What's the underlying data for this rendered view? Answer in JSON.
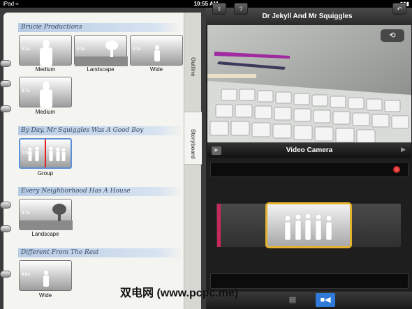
{
  "status_bar": {
    "left": "iPad ≈",
    "time": "10:55 AM",
    "right": "▮▮▮"
  },
  "outline_panel": {
    "tabs": [
      "Outline",
      "Storyboard"
    ],
    "groups": [
      {
        "title": "Brucie Productions",
        "clips": [
          {
            "duration": "0.2s",
            "label": "Medium"
          },
          {
            "duration": "0.2s",
            "label": "Landscape"
          },
          {
            "duration": "0.3s",
            "label": "Wide"
          },
          {
            "duration": "0.7s",
            "label": "Medium"
          }
        ]
      },
      {
        "title": "By Day, Mr Squiggles Was A Good Boy",
        "clips": [
          {
            "duration": "3.3s",
            "label": "Group"
          }
        ]
      },
      {
        "title": "Every Neighborhood Has A House",
        "clips": [
          {
            "duration": "3.7s",
            "label": "Landscape"
          }
        ]
      },
      {
        "title": "Different From The Rest",
        "clips": [
          {
            "duration": "6.0s",
            "label": "Wide"
          }
        ]
      }
    ]
  },
  "toolbar": {
    "project_title": "Dr Jekyll And Mr Squiggles",
    "left_icons": [
      "import-icon",
      "help-icon"
    ],
    "right_icon": "undo-icon"
  },
  "camera": {
    "label": "Video Camera",
    "flip_icon": "camera-switch-icon"
  },
  "colors": {
    "selection": "#5d8fd6",
    "timeline_clip": "#e4b22c",
    "record": "#d41c1c",
    "marker": "#c8285a",
    "active_tab": "#2f79d8"
  },
  "bottom_bar": {
    "icons": [
      "film-strip-icon",
      "video-camera-icon"
    ]
  },
  "watermark": "双电网 (www.pcpc.me)"
}
